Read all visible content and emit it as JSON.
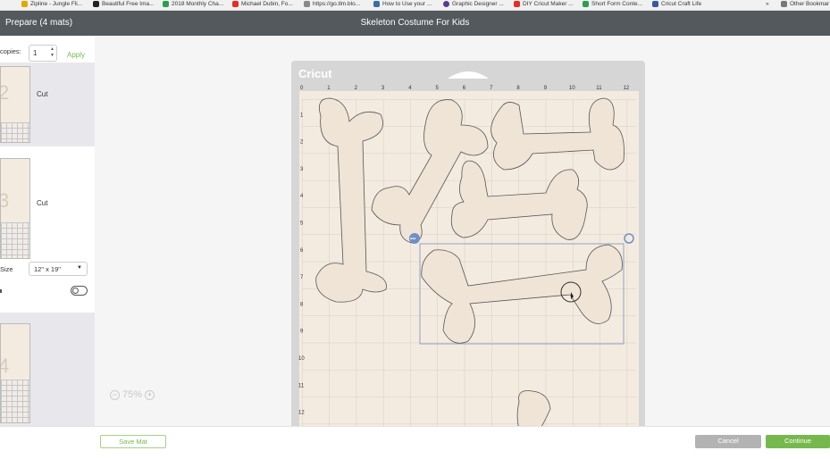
{
  "bookmarks": [
    {
      "label": "Zipline - Jungle Fli...",
      "icon": "zipline-icon",
      "color": "#e0a800"
    },
    {
      "label": "Beautiful Free Ima...",
      "icon": "camera-icon",
      "color": "#222222"
    },
    {
      "label": "2018 Monthly Cha...",
      "icon": "sheet-icon",
      "color": "#2e9e4e"
    },
    {
      "label": "Michael Dubin, Fo...",
      "icon": "youtube-icon",
      "color": "#e52d27"
    },
    {
      "label": "https://go.tlm.blo...",
      "icon": "page-icon",
      "color": "#888888"
    },
    {
      "label": "How to Use your ...",
      "icon": "cricut-icon",
      "color": "#3a6ea5"
    },
    {
      "label": "Graphic Designer ...",
      "icon": "graphic-icon",
      "color": "#5b3a8c"
    },
    {
      "label": "DIY Cricut Maker ...",
      "icon": "youtube-icon",
      "color": "#e52d27"
    },
    {
      "label": "Short Form Conte...",
      "icon": "sheet-icon",
      "color": "#2e9e4e"
    },
    {
      "label": "Cricut Craft Life",
      "icon": "facebook-icon",
      "color": "#3b5998"
    },
    {
      "label": "»",
      "icon": "",
      "color": ""
    },
    {
      "label": "Other Bookmar",
      "icon": "folder-icon",
      "color": "#777777"
    }
  ],
  "header": {
    "left": "Prepare (4 mats)",
    "title": "Skeleton Costume For Kids"
  },
  "sidebar": {
    "copies_label": "copies:",
    "copies_value": "1",
    "apply_label": "Apply",
    "mats": [
      {
        "number": "2",
        "label": "Cut"
      },
      {
        "number": "3",
        "label": "Cut"
      },
      {
        "number": "4",
        "label": ""
      }
    ],
    "size_label": "Size",
    "size_value": "12\" x 19\"",
    "toggle_label": "o"
  },
  "mat": {
    "logo": "Cricut",
    "ruler_x": [
      "0",
      "1",
      "2",
      "3",
      "4",
      "5",
      "6",
      "7",
      "8",
      "9",
      "10",
      "11",
      "12"
    ],
    "ruler_y": [
      "1",
      "2",
      "3",
      "4",
      "5",
      "6",
      "7",
      "8",
      "9",
      "10",
      "11",
      "12"
    ]
  },
  "zoom": {
    "minus": "−",
    "value": "75%",
    "plus": "+"
  },
  "footer": {
    "save_mat": "Save Mat",
    "cancel": "Cancel",
    "continue": "Continue"
  },
  "colors": {
    "accent": "#76b84d",
    "header": "#54595e",
    "mat": "#f4ebe0",
    "selection": "#8ea2c6"
  }
}
